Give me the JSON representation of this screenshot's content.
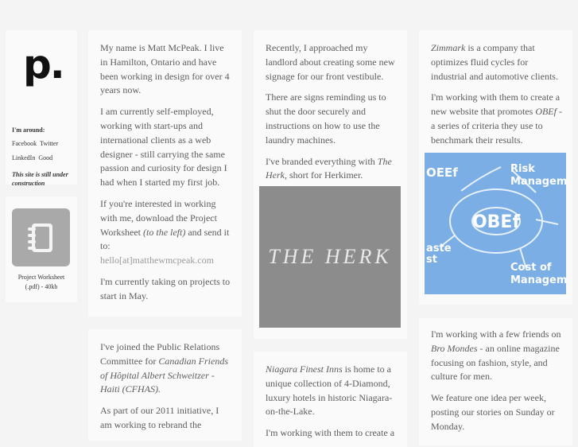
{
  "sidebar": {
    "logo": "p.",
    "around_label": "I'm around:",
    "links": [
      "Facebook",
      "Twitter",
      "LinkedIn",
      "Good"
    ],
    "construction_note": "This site is still under construction",
    "worksheet_line1": "Project Worksheet",
    "worksheet_line2": "(.pdf) - 40kb"
  },
  "col1": {
    "intro": "My name is Matt McPeak. I live in Hamilton, Ontario and have been working in design for over 4 years now.",
    "self_employed": "I am currently self-employed, working with start-ups and international clients as a web designer - still carrying the same passion and curiosity for design I had when I started my first job.",
    "interested_a": "If you're interested in working with me, download the Project Worksheet ",
    "interested_em": "(to the left)",
    "interested_b": " and send it to:",
    "email": "hello[at]matthewmcpeak.com",
    "projects": "I'm currently taking on projects to start in May.",
    "pr_a": "I've joined the Public Relations Committee for ",
    "pr_em": "Canadian Friends of Hôpital Albert Schweitzer - Haiti (CFHAS).",
    "initiative": "As part of our 2011 initiative, I am working to rebrand the"
  },
  "col2": {
    "landlord": "Recently, I approached my landlord about creating some new signage for our front vestibule.",
    "signs": "There are signs reminding us to shut the door securely and instructions on how to use the laundry machines.",
    "branded_a": "I've branded everything with ",
    "branded_em": "The Herk",
    "branded_b": ", short for Herkimer.",
    "herk_title": "THE HERK",
    "niagara_em": "Niagara Finest Inns",
    "niagara_b": " is home to a unique collection of 4-Diamond, luxury hotels in historic Niagara-on-the-Lake.",
    "niagara_more": "I'm working with them to create a"
  },
  "col3": {
    "zimmark_em": "Zimmark",
    "zimmark_b": " is a company that optimizes fluid cycles for industrial and automotive clients.",
    "website_a": "I'm working with them to create a new website that promotes ",
    "website_em": "OBEf",
    "website_b": " - a series of criteria they use to benchmark their results.",
    "obef": {
      "center": "OBEf",
      "top_left": "OEEf",
      "risk": "Risk",
      "manage": "Managem",
      "waste": "aste",
      "st": "st",
      "cost": "Cost of",
      "manage2": "Managem"
    },
    "friends_a": "I'm working with a few friends on ",
    "friends_em": "Bro Mondes",
    "friends_b": " - an online magazine focusing on fashion, style, and culture for men.",
    "feature": "We feature one idea per week, posting our stories on Sunday or Monday."
  }
}
